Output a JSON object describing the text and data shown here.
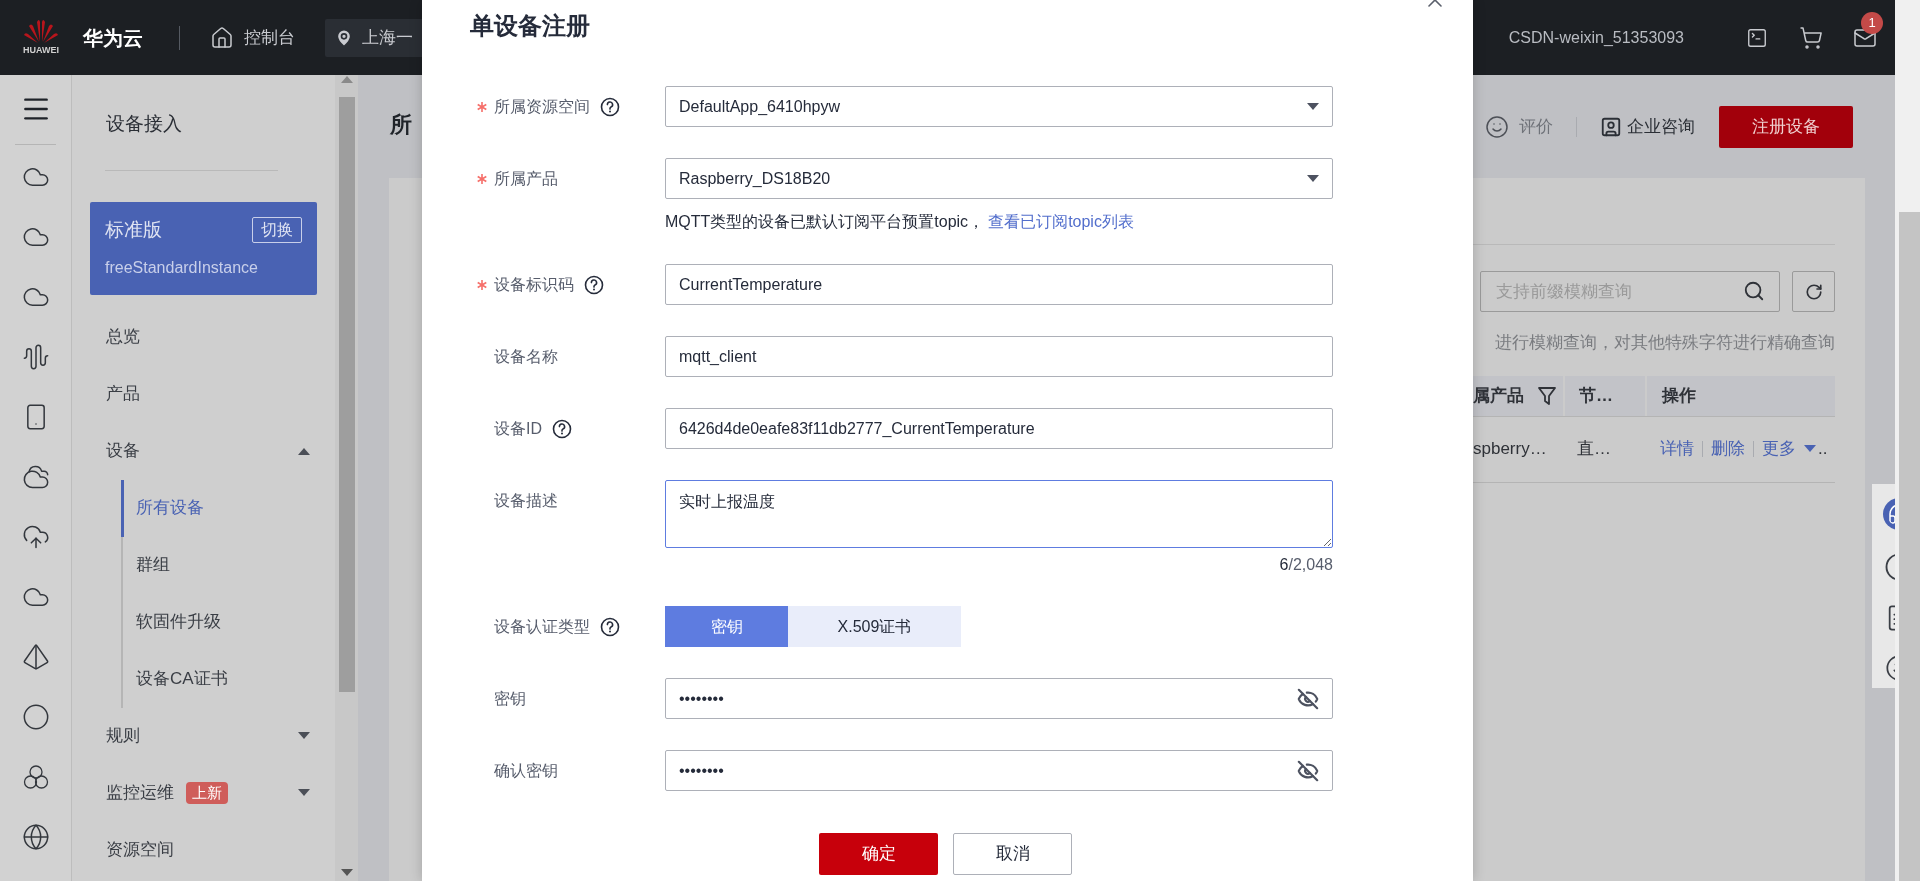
{
  "top_bar": {
    "logo_text": "HUAWEI",
    "site": "华为云",
    "console": "控制台",
    "region": "上海一",
    "user": "CSDN-weixin_51353093",
    "mail_badge": "1"
  },
  "nav": {
    "title": "设备接入",
    "instance": {
      "edition": "标准版",
      "switch": "切换",
      "name": "freeStandardInstance"
    },
    "items": [
      {
        "label": "总览"
      },
      {
        "label": "产品"
      },
      {
        "label": "设备",
        "expanded": true,
        "children": [
          {
            "label": "所有设备",
            "selected": true
          },
          {
            "label": "群组",
            "selected": false
          },
          {
            "label": "软固件升级",
            "selected": false
          },
          {
            "label": "设备CA证书",
            "selected": false
          }
        ]
      },
      {
        "label": "规则",
        "expanded": false
      },
      {
        "label": "监控运维",
        "expanded": false,
        "badge": "上新"
      },
      {
        "label": "资源空间"
      }
    ]
  },
  "page": {
    "title": "所",
    "actions": [
      "评价",
      "企业咨询"
    ],
    "register_button": "注册设备",
    "search": {
      "placeholder": "支持前缀模糊查询"
    },
    "hint": "进行模糊查询，对其他特殊字符进行精确查询",
    "table": {
      "columns": [
        "属产品",
        "节…",
        "操作"
      ],
      "rows": [
        {
          "cells": [
            "spberry…",
            "直…"
          ],
          "actions": [
            "详情",
            "删除",
            "更多"
          ],
          "overflow": ".."
        }
      ]
    }
  },
  "modal": {
    "title": "单设备注册",
    "fields": [
      {
        "kind": "select",
        "label": "所属资源空间",
        "required": true,
        "help": true,
        "value": "DefaultApp_6410hpyw"
      },
      {
        "kind": "select",
        "label": "所属产品",
        "required": true,
        "help": false,
        "value": "Raspberry_DS18B20",
        "note": "MQTT类型的设备已默认订阅平台预置topic，",
        "link": "查看已订阅topic列表"
      },
      {
        "kind": "text",
        "label": "设备标识码",
        "required": true,
        "help": true,
        "value": "CurrentTemperature"
      },
      {
        "kind": "text",
        "label": "设备名称",
        "required": false,
        "help": false,
        "value": "mqtt_client"
      },
      {
        "kind": "text",
        "label": "设备ID",
        "required": false,
        "help": true,
        "value": "6426d4de0eafe83f11db2777_CurrentTemperature"
      },
      {
        "kind": "textarea",
        "label": "设备描述",
        "required": false,
        "help": false,
        "value": "实时上报温度",
        "count": "6",
        "limit": "/2,048"
      },
      {
        "kind": "segmented",
        "label": "设备认证类型",
        "required": false,
        "help": true,
        "options": [
          {
            "label": "密钥",
            "selected": true
          },
          {
            "label": "X.509证书",
            "selected": false
          }
        ]
      },
      {
        "kind": "password",
        "label": "密钥",
        "required": false,
        "help": false,
        "value": "••••••••"
      },
      {
        "kind": "password",
        "label": "确认密钥",
        "required": false,
        "help": false,
        "value": "••••••••"
      }
    ],
    "buttons": [
      {
        "label": "确定",
        "kind": "primary"
      },
      {
        "label": "取消",
        "kind": "secondary"
      }
    ]
  }
}
